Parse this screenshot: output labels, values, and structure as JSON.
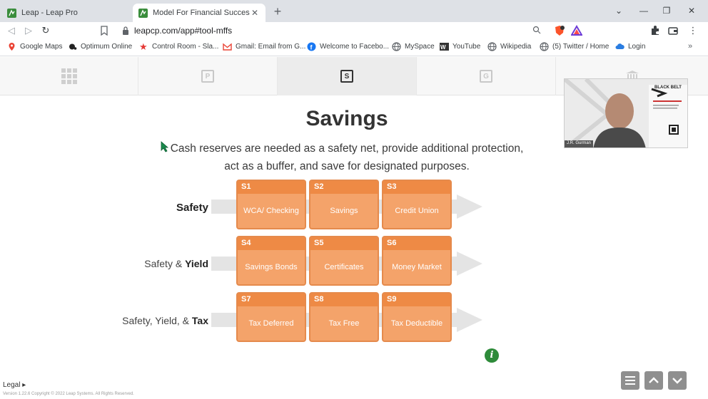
{
  "browser": {
    "tabs": [
      {
        "label": "Leap - Leap Pro",
        "active": false
      },
      {
        "label": "Model For Financial Success - Lea",
        "active": true
      }
    ],
    "url": "leapcp.com/app#tool-mffs",
    "bookmarks": [
      "Google Maps",
      "Optimum Online",
      "Control Room - Sla...",
      "Gmail: Email from G...",
      "Welcome to Facebo...",
      "MySpace",
      "YouTube",
      "Wikipedia",
      "(5) Twitter / Home",
      "Login"
    ]
  },
  "app": {
    "nav_letters": [
      "P",
      "S",
      "G"
    ],
    "active_nav": "S",
    "title": "Savings",
    "subtitle": "Cash reserves are needed as a safety net, provide additional protection, act as a buffer, and save for designated purposes.",
    "rows": [
      {
        "label_prefix": "",
        "label_bold": "Safety"
      },
      {
        "label_prefix": "Safety & ",
        "label_bold": "Yield"
      },
      {
        "label_prefix": "Safety, Yield, & ",
        "label_bold": "Tax"
      }
    ],
    "cells": [
      {
        "code": "S1",
        "text": "WCA/ Checking"
      },
      {
        "code": "S2",
        "text": "Savings"
      },
      {
        "code": "S3",
        "text": "Credit Union"
      },
      {
        "code": "S4",
        "text": "Savings Bonds"
      },
      {
        "code": "S5",
        "text": "Certificates"
      },
      {
        "code": "S6",
        "text": "Money Market"
      },
      {
        "code": "S7",
        "text": "Tax Deferred"
      },
      {
        "code": "S8",
        "text": "Tax Free"
      },
      {
        "code": "S9",
        "text": "Tax Deductible"
      }
    ],
    "video": {
      "name_tag": "J.R. Gurman",
      "logo_text": "BLACK BELT"
    },
    "footer": {
      "legal": "Legal ▸",
      "version": "Version 1.22.6 Copyright © 2022 Leap Systems. All Rights Reserved."
    }
  },
  "colors": {
    "cell_fill": "#f4a36a",
    "cell_header": "#ee8a45",
    "info_green": "#2e8b3a"
  }
}
